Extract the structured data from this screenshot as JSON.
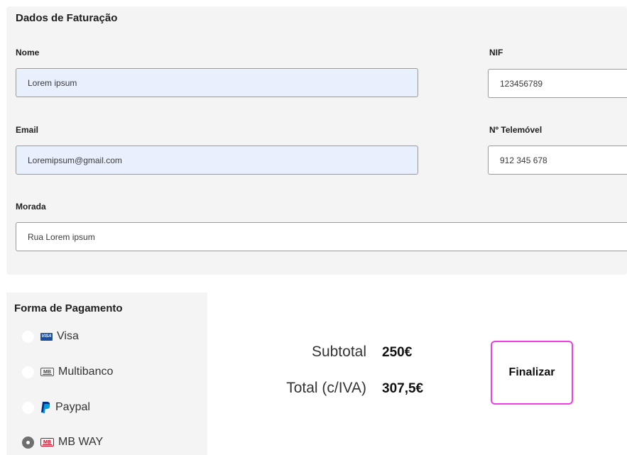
{
  "billing": {
    "title": "Dados de Faturação",
    "name": {
      "label": "Nome",
      "value": "Lorem ipsum"
    },
    "nif": {
      "label": "NIF",
      "value": "123456789"
    },
    "email": {
      "label": "Email",
      "value": "Loremipsum@gmail.com"
    },
    "phone": {
      "label": "Nº Telemóvel",
      "value": "912 345 678"
    },
    "address": {
      "label": "Morada",
      "value": "Rua Lorem ipsum"
    }
  },
  "payment": {
    "title": "Forma de Pagamento",
    "selected": "MB WAY",
    "options": [
      {
        "label": "Visa",
        "icon": "visa-icon",
        "logo_text": "VISA"
      },
      {
        "label": "Multibanco",
        "icon": "multibanco-icon",
        "logo_text": "MB"
      },
      {
        "label": "Paypal",
        "icon": "paypal-icon"
      },
      {
        "label": "MB WAY",
        "icon": "mbway-icon",
        "logo_text": "MB"
      }
    ]
  },
  "totals": {
    "subtotal_label": "Subtotal",
    "subtotal_value": "250€",
    "total_label": "Total (c/IVA)",
    "total_value": "307,5€"
  },
  "finalize_label": "Finalizar",
  "colors": {
    "panel_bg": "#f4f4f4",
    "autofill_bg": "#e8f0fe",
    "finalize_border": "#ee3de8",
    "radio_checked": "#6f6f6f",
    "visa_blue": "#1a4fa0",
    "mbway_red": "#d0021b",
    "paypal_dark": "#003087",
    "paypal_light": "#009cde"
  }
}
